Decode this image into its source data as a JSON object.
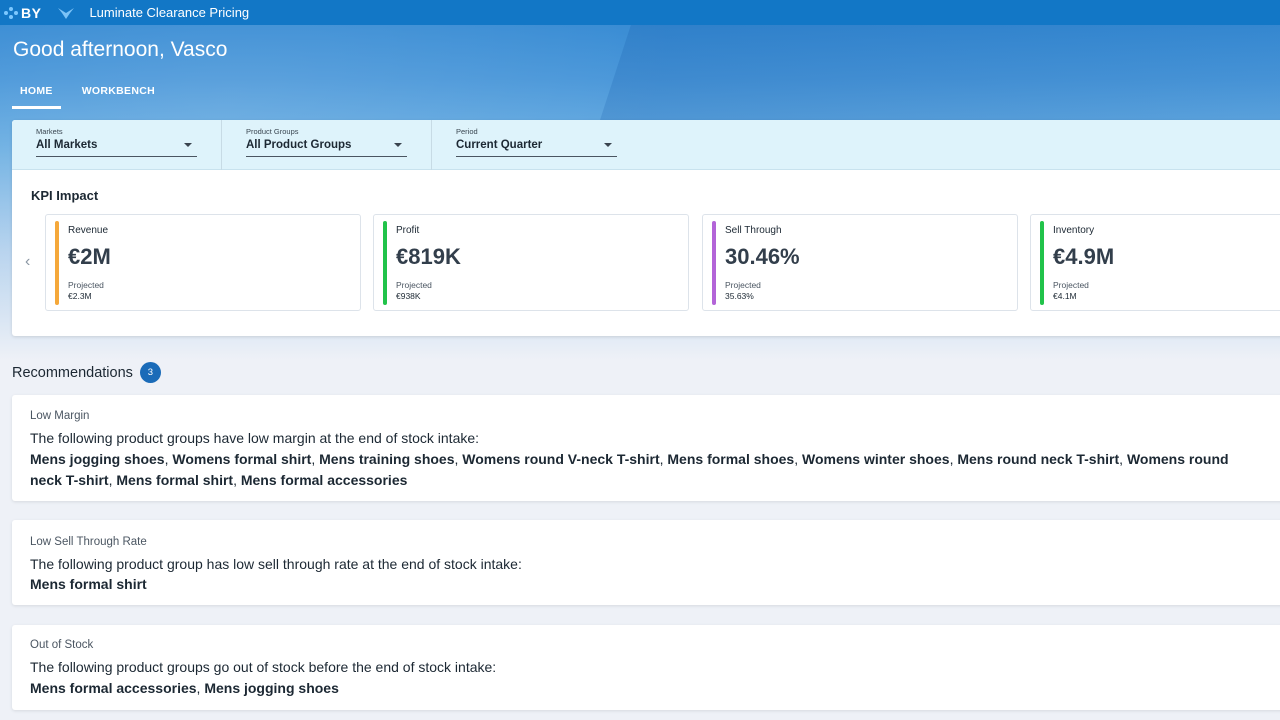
{
  "app": {
    "logo_text": "BY",
    "title": "Luminate Clearance Pricing"
  },
  "greeting": "Good afternoon, Vasco",
  "tabs": [
    {
      "label": "HOME",
      "active": true
    },
    {
      "label": "WORKBENCH",
      "active": false
    }
  ],
  "filters": {
    "markets": {
      "label": "Markets",
      "value": "All Markets"
    },
    "product_groups": {
      "label": "Product Groups",
      "value": "All Product Groups"
    },
    "period": {
      "label": "Period",
      "value": "Current Quarter"
    }
  },
  "kpi": {
    "title": "KPI Impact",
    "cards": [
      {
        "label": "Revenue",
        "value": "€2M",
        "projected_label": "Projected",
        "projected_value": "€2.3M",
        "color": "#f5a83a"
      },
      {
        "label": "Profit",
        "value": "€819K",
        "projected_label": "Projected",
        "projected_value": "€938K",
        "color": "#21c34a"
      },
      {
        "label": "Sell Through",
        "value": "30.46%",
        "projected_label": "Projected",
        "projected_value": "35.63%",
        "color": "#b364d8"
      },
      {
        "label": "Inventory",
        "value": "€4.9M",
        "projected_label": "Projected",
        "projected_value": "€4.1M",
        "color": "#21c34a"
      }
    ]
  },
  "recommendations": {
    "title": "Recommendations",
    "count": "3",
    "items": [
      {
        "label": "Low Margin",
        "description": "The following product groups have low margin at the end of stock intake:",
        "products": [
          "Mens jogging shoes",
          "Womens formal shirt",
          "Mens training shoes",
          "Womens round V-neck T-shirt",
          "Mens formal shoes",
          "Womens winter shoes",
          "Mens round neck T-shirt",
          "Womens round neck T-shirt",
          "Mens formal shirt",
          "Mens formal accessories"
        ]
      },
      {
        "label": "Low Sell Through Rate",
        "description": "The following product group has low sell through rate at the end of stock intake:",
        "products": [
          "Mens formal shirt"
        ]
      },
      {
        "label": "Out of Stock",
        "description": "The following product groups go out of stock before the end of stock intake:",
        "products": [
          "Mens formal accessories",
          "Mens jogging shoes"
        ]
      }
    ]
  },
  "colors": {
    "topbar": "#1277c6",
    "badge": "#1a6bb8",
    "filter_bg": "#def3fb"
  }
}
